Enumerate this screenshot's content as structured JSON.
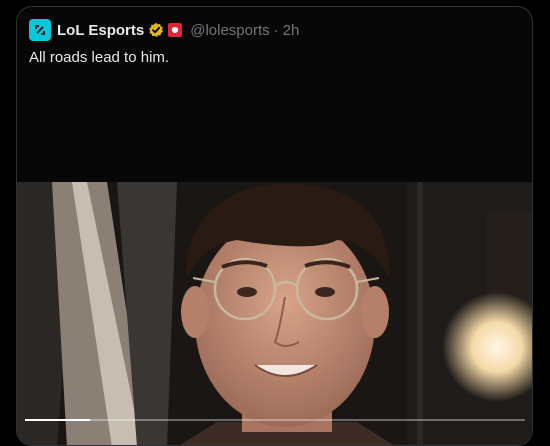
{
  "tweet": {
    "author_name": "LoL Esports",
    "handle": "@lolesports",
    "separator": "·",
    "time": "2h",
    "text": "All roads lead to him."
  },
  "icons": {
    "avatar": "lol-esports-logo-icon",
    "verified": "verified-gold-badge-icon",
    "affiliate": "affiliate-badge-icon"
  },
  "colors": {
    "avatar_bg": "#0ac8d9",
    "verified_gold": "#e2b719",
    "affiliate_red": "#e0243a",
    "text_primary": "#e7e9ea",
    "text_secondary": "#71767b"
  },
  "video": {
    "progress": 0.13
  }
}
